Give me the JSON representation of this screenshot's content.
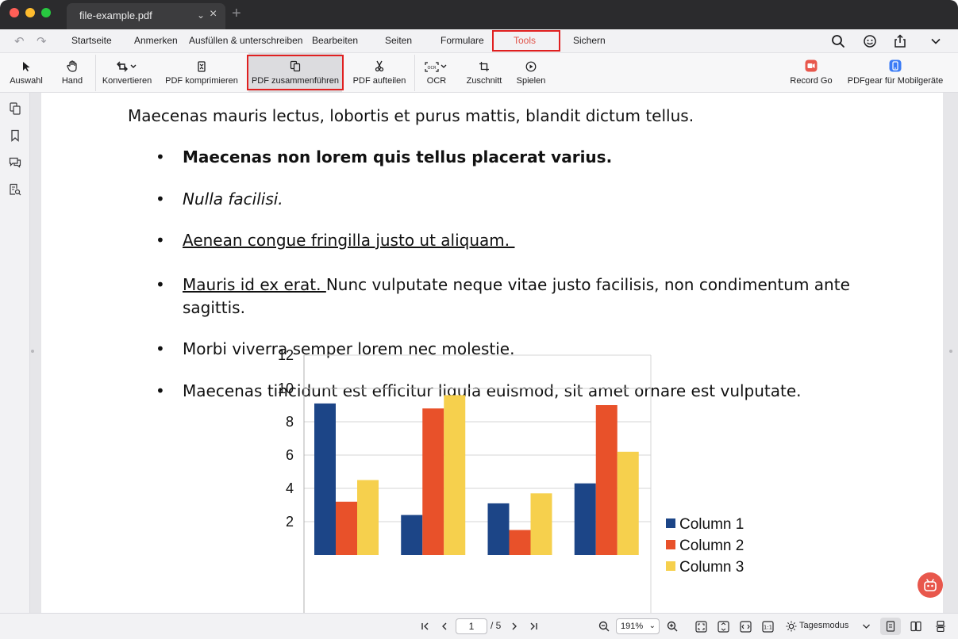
{
  "window": {
    "tab_title": "file-example.pdf"
  },
  "menu": {
    "items": [
      "Startseite",
      "Anmerken",
      "Ausfüllen & unterschreiben",
      "Bearbeiten",
      "Seiten",
      "Formulare",
      "Tools",
      "Sichern"
    ],
    "active": "Tools",
    "active_color": "#e0544a"
  },
  "toolbar": {
    "tools": [
      {
        "label": "Auswahl",
        "icon": "cursor-icon"
      },
      {
        "label": "Hand",
        "icon": "hand-icon"
      },
      {
        "label": "Konvertieren",
        "icon": "convert-icon"
      },
      {
        "label": "PDF komprimieren",
        "icon": "compress-icon"
      },
      {
        "label": "PDF zusammenführen",
        "icon": "merge-icon"
      },
      {
        "label": "PDF aufteilen",
        "icon": "scissors-icon"
      },
      {
        "label": "OCR",
        "icon": "ocr-icon"
      },
      {
        "label": "Zuschnitt",
        "icon": "crop-icon"
      },
      {
        "label": "Spielen",
        "icon": "play-icon"
      },
      {
        "label": "Record Go",
        "icon": "record-icon"
      },
      {
        "label": "PDFgear für Mobilgeräte",
        "icon": "mobile-icon"
      }
    ],
    "active": "PDF zusammenführen"
  },
  "document": {
    "intro": "Maecenas mauris lectus, lobortis et purus mattis, blandit dictum tellus.",
    "bullets": [
      {
        "text": "Maecenas non lorem quis tellus placerat varius."
      },
      {
        "text": "Nulla facilisi."
      },
      {
        "text": "Aenean congue fringilla justo ut aliquam. "
      },
      {
        "underlined": "Mauris id ex erat. ",
        "text": "Nunc vulputate neque vitae justo facilisis, non condimentum ante",
        "continuation": "sagittis."
      },
      {
        "text": "Morbi viverra semper lorem nec molestie."
      },
      {
        "text": "Maecenas tincidunt est efficitur ligula euismod, sit amet ornare est vulputate."
      }
    ]
  },
  "chart_data": {
    "type": "bar",
    "categories": [
      "",
      "",
      "",
      ""
    ],
    "series": [
      {
        "name": "Column 1",
        "values": [
          9.1,
          2.4,
          3.1,
          4.3
        ],
        "color": "#1c4587"
      },
      {
        "name": "Column 2",
        "values": [
          3.2,
          8.8,
          1.5,
          9.0
        ],
        "color": "#e8512a"
      },
      {
        "name": "Column 3",
        "values": [
          4.5,
          9.6,
          3.7,
          6.2
        ],
        "color": "#f6d04d"
      }
    ],
    "yticks": [
      2,
      4,
      6,
      8,
      10,
      12
    ],
    "ylim": [
      0,
      12
    ],
    "legend": "right",
    "grid": true
  },
  "statusbar": {
    "current_page": "1",
    "page_total": "/ 5",
    "zoom": "191%",
    "mode": "Tagesmodus"
  }
}
